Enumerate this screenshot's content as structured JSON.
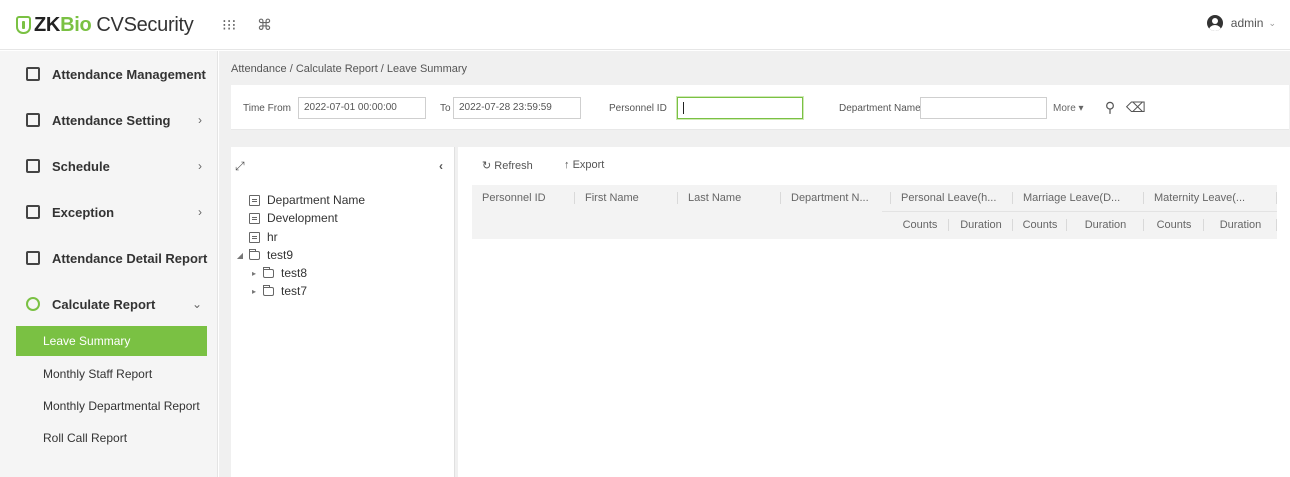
{
  "app": {
    "brand_zk": "ZK",
    "brand_bio": "Bio",
    "brand_cv": "CVSecurity",
    "apps_icon": "grid-icon",
    "shortcut_icon": "command-icon",
    "user_name": "admin",
    "user_caret": "⌄"
  },
  "sidebar": {
    "items": [
      {
        "label": "Attendance Management",
        "arrow": "›"
      },
      {
        "label": "Attendance Setting",
        "arrow": "›"
      },
      {
        "label": "Schedule",
        "arrow": "›"
      },
      {
        "label": "Exception",
        "arrow": "›"
      },
      {
        "label": "Attendance Detail Report",
        "arrow": "›"
      },
      {
        "label": "Calculate Report",
        "arrow": "⌄"
      }
    ],
    "sub_items": [
      {
        "label": "Leave Summary",
        "active": true
      },
      {
        "label": "Monthly Staff Report"
      },
      {
        "label": "Monthly Departmental Report"
      },
      {
        "label": "Roll Call Report"
      }
    ],
    "accent_color": "#7ac143"
  },
  "breadcrumb": "Attendance / Calculate Report / Leave Summary",
  "filter": {
    "time_from_label": "Time From",
    "time_from_value": "2022-07-01 00:00:00",
    "to_label": "To",
    "to_value": "2022-07-28 23:59:59",
    "personnel_id_label": "Personnel ID",
    "personnel_id_value": "",
    "department_name_label": "Department Name",
    "department_name_value": "",
    "more_label": "More ▾",
    "search_icon": "search-icon",
    "clear_icon": "eraser-icon"
  },
  "tree": {
    "expand_icon": "expand-icon",
    "collapse_panel_icon": "chevron-left-icon",
    "nodes": [
      {
        "label": "Department Name",
        "icon": "document-icon"
      },
      {
        "label": "Development",
        "icon": "document-icon"
      },
      {
        "label": "hr",
        "icon": "document-icon"
      },
      {
        "label": "test9",
        "icon": "folder-open-icon",
        "toggle": "◢"
      },
      {
        "label": "test8",
        "icon": "folder-icon",
        "toggle": "▸"
      },
      {
        "label": "test7",
        "icon": "folder-icon",
        "toggle": "▸"
      }
    ]
  },
  "toolbar": {
    "refresh_label": "Refresh",
    "export_label": "Export"
  },
  "table": {
    "columns": [
      "Personnel ID",
      "First Name",
      "Last Name",
      "Department N...",
      "Personal Leave(h...",
      "Marriage Leave(D...",
      "Maternity Leave(..."
    ],
    "sub_columns": [
      "Counts",
      "Duration",
      "Counts",
      "Duration",
      "Counts",
      "Duration"
    ],
    "rows": []
  }
}
